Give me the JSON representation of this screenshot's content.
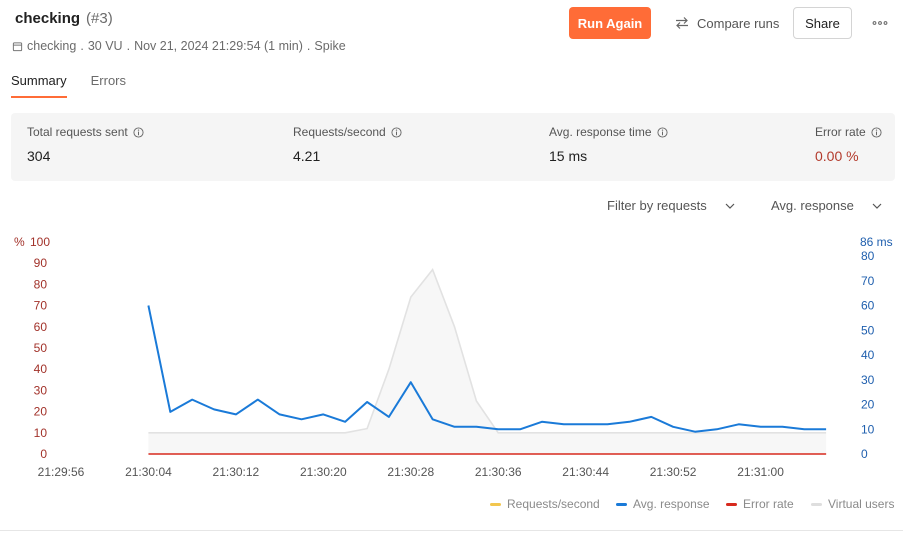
{
  "header": {
    "title": "checking",
    "run_number": "(#3)",
    "subtitle": {
      "collection": "checking",
      "vus": "30 VU",
      "datetime": "Nov 21, 2024 21:29:54 (1 min)",
      "profile": "Spike"
    },
    "run_again_label": "Run Again",
    "compare_label": "Compare runs",
    "share_label": "Share"
  },
  "tabs": [
    {
      "label": "Summary",
      "active": true
    },
    {
      "label": "Errors",
      "active": false
    }
  ],
  "stats": [
    {
      "label": "Total requests sent",
      "value": "304"
    },
    {
      "label": "Requests/second",
      "value": "4.21"
    },
    {
      "label": "Avg. response time",
      "value": "15 ms"
    },
    {
      "label": "Error rate",
      "value": "0.00 %"
    }
  ],
  "filters": {
    "requests_label": "Filter by requests",
    "metric_label": "Avg. response"
  },
  "colors": {
    "accent": "#ff6c37",
    "avg_response": "#1a7ad8",
    "error_rate": "#d72a1e",
    "requests_per_second": "#f2c64e",
    "virtual_users": "#e2e2e2",
    "left_axis": "#a2322a",
    "right_axis": "#1f5fae"
  },
  "chart_data": {
    "type": "line",
    "x_ticks": [
      "21:29:56",
      "21:30:04",
      "21:30:12",
      "21:30:20",
      "21:30:28",
      "21:30:36",
      "21:30:44",
      "21:30:52",
      "21:31:00"
    ],
    "x_seconds_range": [
      -2,
      70
    ],
    "left_axis": {
      "ticks": [
        "0",
        "10",
        "20",
        "30",
        "40",
        "50",
        "60",
        "70",
        "80",
        "90",
        "100"
      ],
      "top_label": "%",
      "range": [
        0,
        100
      ]
    },
    "right_axis": {
      "ticks": [
        "0",
        "10",
        "20",
        "30",
        "40",
        "50",
        "60",
        "70",
        "80"
      ],
      "top_label": "86 ms",
      "range": [
        0,
        86
      ]
    },
    "series": [
      {
        "name": "Avg. response",
        "axis": "right",
        "x": [
          6,
          8,
          10,
          12,
          14,
          16,
          18,
          20,
          22,
          24,
          26,
          28,
          30,
          32,
          34,
          36,
          38,
          40,
          42,
          44,
          46,
          48,
          50,
          52,
          54,
          56,
          58,
          60,
          62,
          64,
          66,
          68
        ],
        "y": [
          60,
          17,
          22,
          18,
          16,
          22,
          16,
          14,
          16,
          13,
          21,
          15,
          29,
          14,
          11,
          11,
          10,
          10,
          13,
          12,
          12,
          12,
          13,
          15,
          11,
          9,
          10,
          12,
          11,
          11,
          10,
          10
        ]
      },
      {
        "name": "Error rate",
        "axis": "left",
        "x": [
          6,
          68
        ],
        "y": [
          0,
          0
        ]
      },
      {
        "name": "Virtual users",
        "axis": "left",
        "x": [
          6,
          24,
          26,
          28,
          30,
          32,
          34,
          36,
          38,
          40,
          68
        ],
        "y": [
          10,
          10,
          12,
          40,
          74,
          87,
          60,
          25,
          10,
          10,
          10
        ]
      }
    ],
    "legend": [
      "Requests/second",
      "Avg. response",
      "Error rate",
      "Virtual users"
    ],
    "legend_position": "bottom-right"
  }
}
